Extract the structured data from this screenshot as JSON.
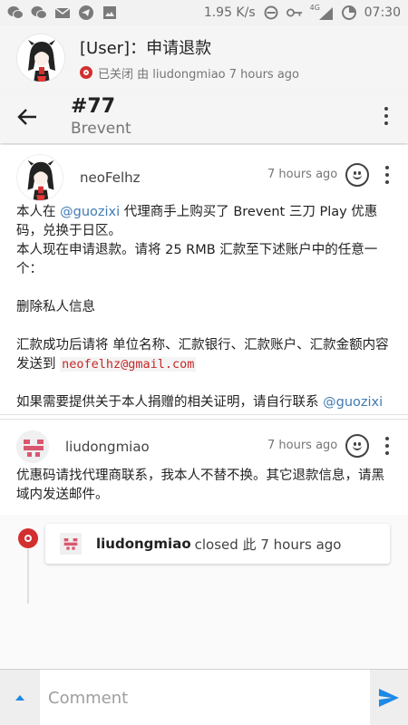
{
  "status_bar": {
    "network_speed": "1.95 K/s",
    "network_type": "4G",
    "time": "07:30",
    "left_icons": [
      "wechat-icon",
      "wechat-icon",
      "mail-icon",
      "telegram-icon",
      "image-icon"
    ],
    "right_icons": [
      "no-sim-icon",
      "alarm-icon",
      "key-icon",
      "signal-icon",
      "battery-icon"
    ]
  },
  "issue": {
    "title": "[User]：申请退款",
    "status_line": "已关闭 由 liudongmiao 7 hours ago",
    "status_color": "#d32f2f"
  },
  "toolbar": {
    "number": "#77",
    "repo": "Brevent"
  },
  "comments": [
    {
      "author": "neoFelhz",
      "time": "7 hours ago",
      "body": {
        "p1_a": "本人在 ",
        "p1_mention": "@guozixi",
        "p1_b": " 代理商手上购买了 Brevent 三刀 Play 优惠码，兑换于日区。",
        "p1_c": "本人现在申请退款。请将 25 RMB 汇款至下述账户中的任意一个：",
        "p2": "删除私人信息",
        "p3_a": "汇款成功后请将 单位名称、汇款银行、汇款账户、汇款金额内容发送到 ",
        "p3_email": "neofelhz@gmail.com",
        "p4_a": "如果需要提供关于本人捐赠的相关证明，请自行联系 ",
        "p4_mention": "@guozixi"
      }
    },
    {
      "author": "liudongmiao",
      "time": "7 hours ago",
      "body": {
        "text": "优惠码请找代理商联系，我本人不替不换。其它退款信息，请黑域内发送邮件。"
      }
    }
  ],
  "event": {
    "actor": "liudongmiao",
    "action": "closed 此 7 hours ago"
  },
  "composer": {
    "placeholder": "Comment"
  },
  "colors": {
    "accent": "#1e88e5",
    "mention": "#3f7bb4",
    "email": "#c62828",
    "closed": "#d32f2f"
  }
}
